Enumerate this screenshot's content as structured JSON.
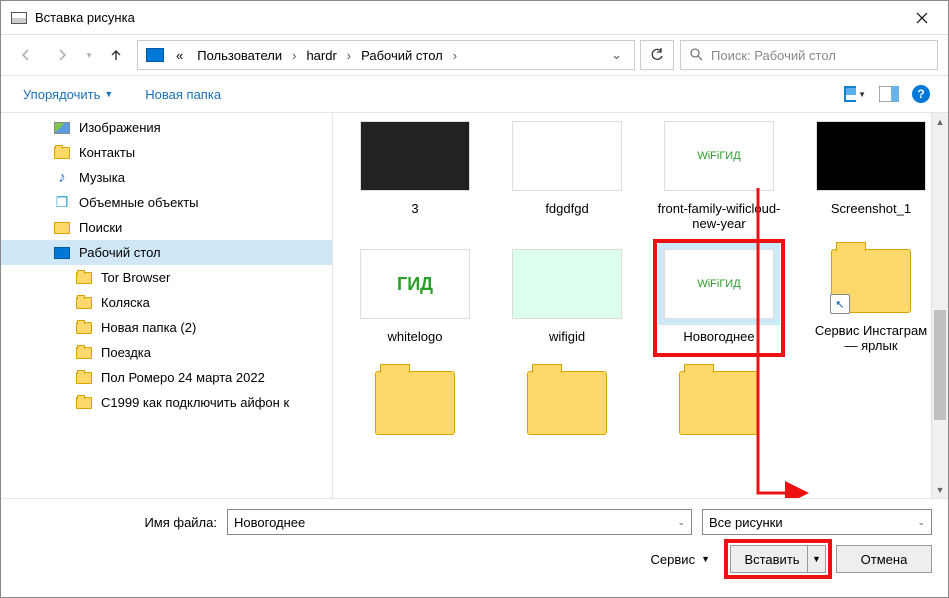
{
  "window": {
    "title": "Вставка рисунка"
  },
  "breadcrumb": {
    "prefix": "«",
    "parts": [
      "Пользователи",
      "hardr",
      "Рабочий стол"
    ]
  },
  "search": {
    "placeholder": "Поиск: Рабочий стол"
  },
  "toolbar": {
    "organize": "Упорядочить",
    "new_folder": "Новая папка"
  },
  "tree": {
    "items": [
      {
        "label": "Изображения",
        "icon": "pictures",
        "depth": 1
      },
      {
        "label": "Контакты",
        "icon": "folder",
        "depth": 1
      },
      {
        "label": "Музыка",
        "icon": "music",
        "depth": 1
      },
      {
        "label": "Объемные объекты",
        "icon": "cube",
        "depth": 1
      },
      {
        "label": "Поиски",
        "icon": "search",
        "depth": 1
      },
      {
        "label": "Рабочий стол",
        "icon": "desktop",
        "depth": 1,
        "selected": true
      },
      {
        "label": "Tor Browser",
        "icon": "folder",
        "depth": 2
      },
      {
        "label": "Коляска",
        "icon": "folder",
        "depth": 2
      },
      {
        "label": "Новая папка (2)",
        "icon": "folder",
        "depth": 2
      },
      {
        "label": "Поездка",
        "icon": "folder",
        "depth": 2
      },
      {
        "label": "Пол Ромеро 24 марта 2022",
        "icon": "folder",
        "depth": 2
      },
      {
        "label": "С1999 как подключить айфон к",
        "icon": "folder",
        "depth": 2
      }
    ]
  },
  "files": {
    "row1": [
      {
        "name": "3",
        "thumb_text": "",
        "thumb_bg": "#222",
        "thumb_fg": "#4f4"
      },
      {
        "name": "fdgdfgd",
        "thumb_text": "",
        "thumb_bg": "#fff"
      },
      {
        "name": "front-family-wificloud-new-year",
        "thumb_text": "WiFiГИД",
        "thumb_bg": "#fff",
        "thumb_fg": "#2aa02a"
      },
      {
        "name": "Screenshot_1",
        "thumb_text": "",
        "thumb_bg": "#000"
      }
    ],
    "row2": [
      {
        "name": "whitelogo",
        "thumb_text": "ГИД",
        "thumb_bg": "#fff",
        "thumb_fg": "#2aa02a",
        "thumb_bold": true
      },
      {
        "name": "wifigid",
        "thumb_text": "",
        "thumb_bg": "#dfe"
      },
      {
        "name": "Новогоднее",
        "thumb_text": "WiFiГИД",
        "thumb_bg": "#fff",
        "thumb_fg": "#2aa02a",
        "selected": true
      },
      {
        "name": "Сервис Инстаграм — ярлык",
        "folder": true,
        "shortcut": true
      }
    ],
    "row3": [
      {
        "name": "",
        "folder": true
      },
      {
        "name": "",
        "folder": true
      },
      {
        "name": "",
        "folder": true
      }
    ]
  },
  "footer": {
    "filename_label": "Имя файла:",
    "filename_value": "Новогоднее",
    "filter": "Все рисунки",
    "service": "Сервис",
    "insert": "Вставить",
    "cancel": "Отмена"
  }
}
